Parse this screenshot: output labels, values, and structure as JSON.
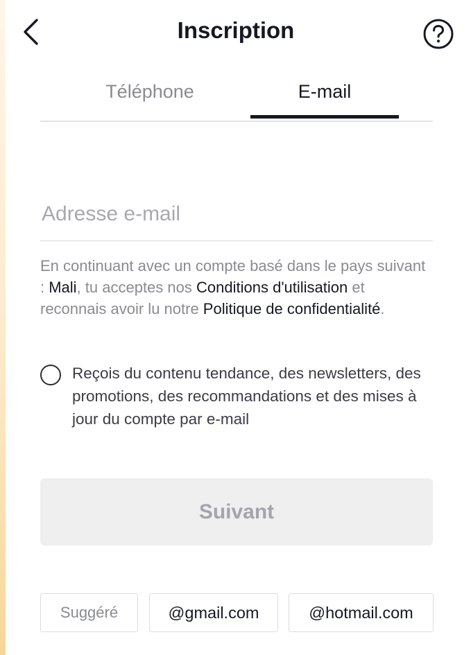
{
  "header": {
    "title": "Inscription",
    "back_icon": "chevron-left-icon",
    "help_icon": "question-circle-icon"
  },
  "tabs": [
    {
      "label": "Téléphone",
      "active": false
    },
    {
      "label": "E-mail",
      "active": true
    }
  ],
  "email_field": {
    "placeholder": "Adresse e-mail",
    "value": ""
  },
  "terms": {
    "part1": "En continuant avec un compte basé dans le pays suivant : ",
    "country": "Mali",
    "part2": ", tu acceptes nos ",
    "terms_link": "Conditions d'utilisation",
    "part3": " et reconnais avoir lu notre ",
    "privacy_link": "Politique de confidentialité",
    "part4": "."
  },
  "opt_in": {
    "label": "Reçois du contenu tendance, des newsletters, des promotions, des recommandations et des mises à jour du compte par e-mail",
    "checked": false
  },
  "next_button": {
    "label": "Suivant",
    "enabled": false
  },
  "suggestions": {
    "label": "Suggéré",
    "domains": [
      "@gmail.com",
      "@hotmail.com"
    ]
  },
  "colors": {
    "text_primary": "#161823",
    "text_secondary": "#8a8b91",
    "tab_underline": "#161823",
    "button_disabled_bg": "#efeff0",
    "button_disabled_text": "#a4a5aa"
  }
}
